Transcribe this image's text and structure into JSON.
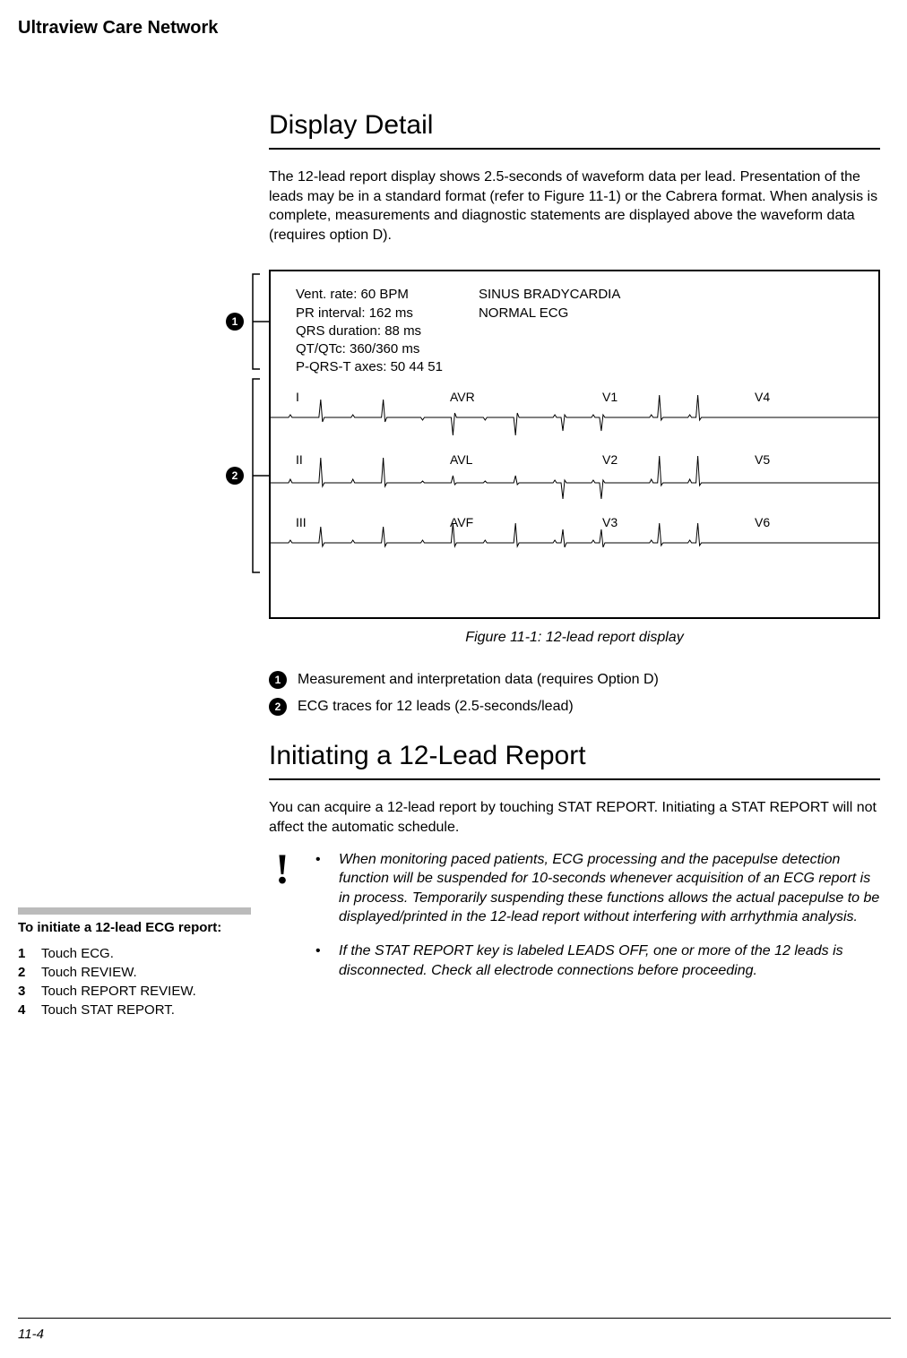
{
  "header": "Ultraview Care Network",
  "section1": {
    "title": "Display Detail",
    "para": "The 12-lead report display shows 2.5-seconds of waveform data per lead. Presentation of the leads may be in a standard format (refer to Figure 11-1) or the Cabrera format. When analysis is complete, measurements and diagnostic statements are displayed above the waveform data (requires option D)."
  },
  "figure": {
    "measurements": {
      "vent_rate": "Vent. rate: 60 BPM",
      "pr": "PR interval: 162 ms",
      "qrs": "QRS duration: 88 ms",
      "qt": "QT/QTc: 360/360 ms",
      "axes": "P-QRS-T axes: 50   44   51",
      "diag1": "SINUS BRADYCARDIA",
      "diag2": "NORMAL ECG"
    },
    "leads": {
      "row1": [
        "I",
        "AVR",
        "V1",
        "V4"
      ],
      "row2": [
        "II",
        "AVL",
        "V2",
        "V5"
      ],
      "row3": [
        "III",
        "AVF",
        "V3",
        "V6"
      ]
    },
    "caption": "Figure 11-1: 12-lead report display",
    "callouts": {
      "c1": "1",
      "c2": "2"
    },
    "legend": {
      "l1": "Measurement and interpretation data (requires Option D)",
      "l2": "ECG traces for 12 leads (2.5-seconds/lead)"
    }
  },
  "section2": {
    "title": "Initiating a 12-Lead Report",
    "para": "You can acquire a 12-lead report by touching STAT REPORT. Initiating a STAT REPORT will not affect the automatic schedule.",
    "notes": {
      "n1": "When monitoring paced patients, ECG processing and the pacepulse detection function will be suspended for 10-seconds whenever acquisition of an ECG report is in process. Temporarily suspending these functions allows the actual pacepulse to be displayed/printed in the 12-lead report without interfering with arrhythmia analysis.",
      "n2": "If the STAT REPORT key is labeled LEADS OFF, one or more of the 12 leads is disconnected. Check all electrode connections before proceeding."
    }
  },
  "sidenote": {
    "title": "To initiate a 12-lead ECG report:",
    "items": [
      {
        "num": "1",
        "text": "Touch ECG."
      },
      {
        "num": "2",
        "text": "Touch REVIEW."
      },
      {
        "num": "3",
        "text": "Touch REPORT REVIEW."
      },
      {
        "num": "4",
        "text": "Touch STAT REPORT."
      }
    ]
  },
  "page_num": "11-4"
}
